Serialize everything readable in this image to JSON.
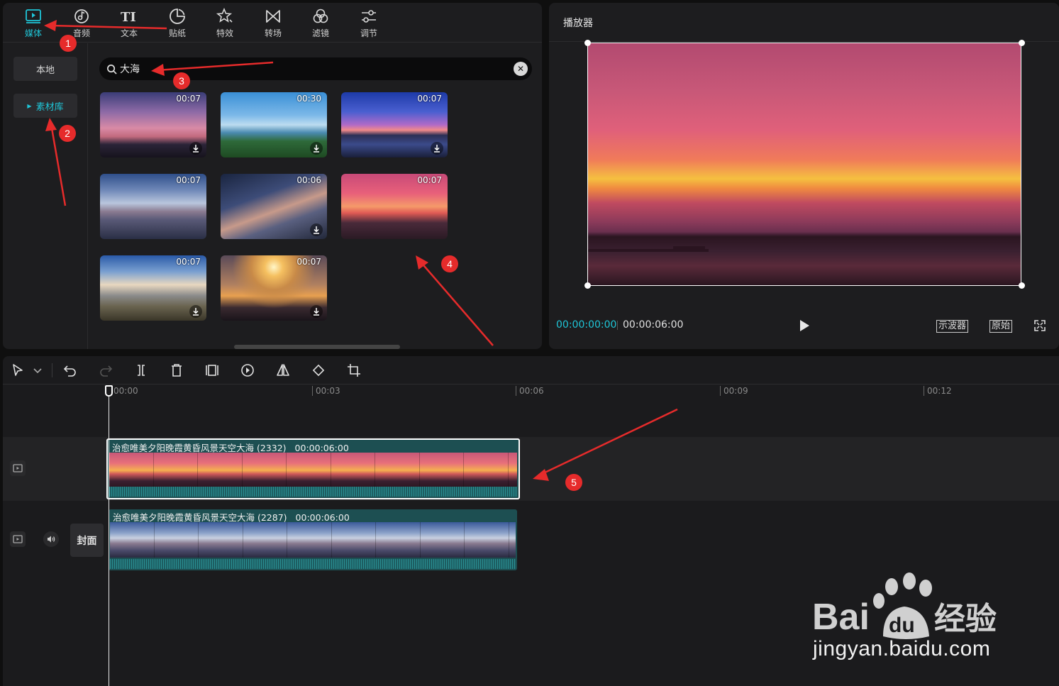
{
  "tabs": [
    {
      "label": "媒体",
      "icon": "media-icon",
      "active": true
    },
    {
      "label": "音频",
      "icon": "audio-icon",
      "active": false
    },
    {
      "label": "文本",
      "icon": "text-icon",
      "active": false
    },
    {
      "label": "贴纸",
      "icon": "sticker-icon",
      "active": false
    },
    {
      "label": "特效",
      "icon": "effects-icon",
      "active": false
    },
    {
      "label": "转场",
      "icon": "transition-icon",
      "active": false
    },
    {
      "label": "滤镜",
      "icon": "filter-icon",
      "active": false
    },
    {
      "label": "调节",
      "icon": "adjust-icon",
      "active": false
    }
  ],
  "sidebar": {
    "local": "本地",
    "library": "素材库"
  },
  "search": {
    "value": "大海"
  },
  "thumbnails": [
    {
      "duration": "00:07"
    },
    {
      "duration": "00:30"
    },
    {
      "duration": "00:07"
    },
    {
      "duration": "00:07"
    },
    {
      "duration": "00:06"
    },
    {
      "duration": "00:07"
    },
    {
      "duration": "00:07"
    },
    {
      "duration": "00:07"
    }
  ],
  "player": {
    "title": "播放器",
    "current_time": "00:00:00:00",
    "total_time": "00:00:06:00",
    "scope_button": "示波器",
    "original_button": "原始"
  },
  "ruler": {
    "labels": [
      "00:00",
      "00:03",
      "00:06",
      "00:09",
      "00:12"
    ]
  },
  "tracks": {
    "cover_label": "封面",
    "clips": [
      {
        "name": "治愈唯美夕阳晚霞黄昏风景天空大海 (2332)",
        "duration": "00:00:06:00",
        "selected": true
      },
      {
        "name": "治愈唯美夕阳晚霞黄昏风景天空大海 (2287)",
        "duration": "00:00:06:00",
        "selected": false
      }
    ]
  },
  "annotations": {
    "steps": [
      "1",
      "2",
      "3",
      "4",
      "5"
    ],
    "arrow_color": "#e62b2b"
  },
  "watermark": {
    "brand_latin": "Bai",
    "brand_latin_2": "du",
    "brand_cn": "经验",
    "url": "jingyan.baidu.com"
  },
  "colors": {
    "accent": "#1fc6d8",
    "panel": "#1d1d1f",
    "clip": "#1d4f52"
  }
}
